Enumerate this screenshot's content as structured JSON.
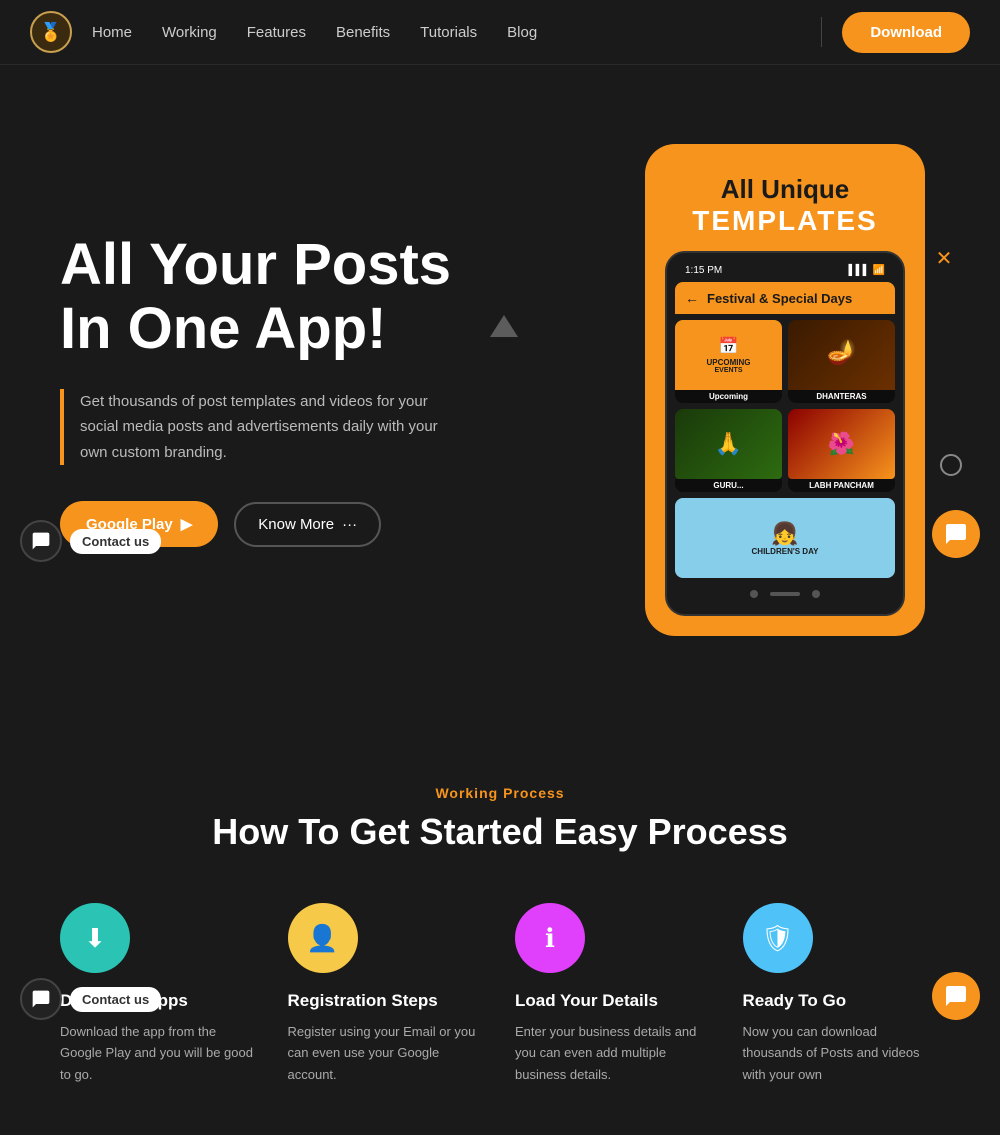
{
  "navbar": {
    "logo_emoji": "🏅",
    "links": [
      {
        "label": "Home",
        "href": "#"
      },
      {
        "label": "Working",
        "href": "#"
      },
      {
        "label": "Features",
        "href": "#"
      },
      {
        "label": "Benefits",
        "href": "#"
      },
      {
        "label": "Tutorials",
        "href": "#"
      },
      {
        "label": "Blog",
        "href": "#"
      }
    ],
    "download_label": "Download"
  },
  "hero": {
    "title_line1": "All Your Posts",
    "title_line2": "In One App!",
    "description": "Get thousands of post templates and videos for your social media posts and advertisements daily with your own custom branding.",
    "btn_google_play": "Google Play",
    "btn_know_more": "Know More",
    "phone_heading1": "All Unique",
    "phone_heading2": "TEMPLATES",
    "phone_app_title": "Festival  &  Special Days",
    "card1_label": "Upcoming",
    "card2_label": "DHANTERAS",
    "card3_label": "GURU...",
    "card4_label": "LABH PANCHAM",
    "children_label": "CHILDREN'S DAY"
  },
  "contact": {
    "label": "Contact us",
    "label2": "Contact us"
  },
  "working": {
    "tag": "Working Process",
    "title": "How To Get Started Easy Process",
    "steps": [
      {
        "icon": "⬇",
        "color": "teal",
        "title": "Download Apps",
        "desc": "Download the app from the Google Play and you will be good to go."
      },
      {
        "icon": "👤",
        "color": "yellow",
        "title": "Registration Steps",
        "desc": "Register using your Email or you can even use your Google account."
      },
      {
        "icon": "ℹ",
        "color": "pink",
        "title": "Load Your Details",
        "desc": "Enter your business details and you can even add multiple business details."
      },
      {
        "icon": "🛡",
        "color": "blue",
        "title": "Ready To Go",
        "desc": "Now you can download thousands of Posts and videos with your own"
      }
    ]
  }
}
